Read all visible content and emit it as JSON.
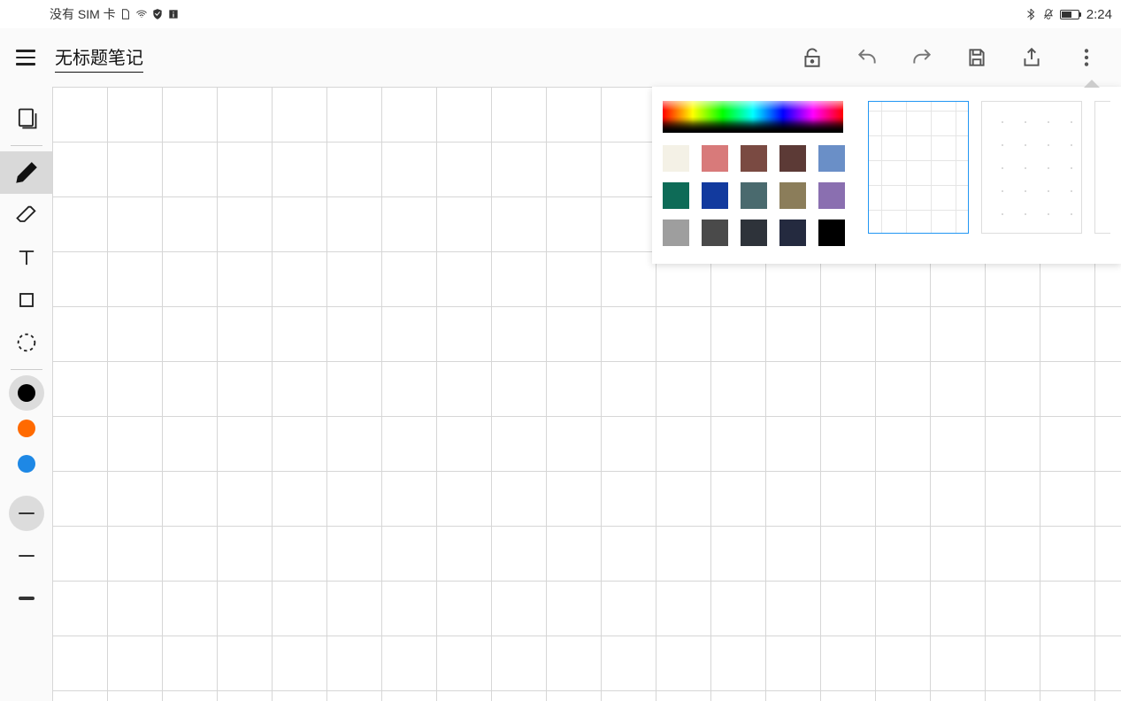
{
  "status": {
    "sim_text": "没有 SIM 卡",
    "time": "2:24",
    "icons": [
      "sim-icon",
      "wifi-icon",
      "shield-icon",
      "info-icon"
    ],
    "right_icons": [
      "bluetooth-icon",
      "mute-icon",
      "battery-icon"
    ]
  },
  "header": {
    "title": "无标题笔记",
    "actions": {
      "lock": "lock",
      "undo": "undo",
      "redo": "redo",
      "save": "save",
      "share": "share",
      "more": "more"
    }
  },
  "sidebar": {
    "tools": [
      {
        "name": "page-tool"
      },
      {
        "name": "pen-tool",
        "active": true
      },
      {
        "name": "eraser-tool"
      },
      {
        "name": "text-tool"
      },
      {
        "name": "shape-tool"
      },
      {
        "name": "lasso-tool"
      }
    ],
    "colors": [
      {
        "name": "color-black",
        "hex": "#000000",
        "selected": true
      },
      {
        "name": "color-orange",
        "hex": "#ff6a00",
        "selected": false
      },
      {
        "name": "color-blue",
        "hex": "#1e88e5",
        "selected": false
      }
    ],
    "strokes": [
      {
        "name": "stroke-thin",
        "selected": true
      },
      {
        "name": "stroke-medium",
        "selected": false
      },
      {
        "name": "stroke-thick",
        "selected": false
      }
    ]
  },
  "popup": {
    "palette": [
      "#f4f1e6",
      "#d87a7a",
      "#7a4a42",
      "#5c3a36",
      "#6a8fc7",
      "#0e6b57",
      "#123a9e",
      "#4a6a6e",
      "#8b7d5a",
      "#8a6fb0",
      "#9e9e9e",
      "#4a4a4a",
      "#2e333a",
      "#242a3f",
      "#000000"
    ],
    "templates": [
      {
        "name": "template-grid",
        "selected": true
      },
      {
        "name": "template-dots",
        "selected": false
      },
      {
        "name": "template-blank",
        "selected": false
      }
    ]
  }
}
